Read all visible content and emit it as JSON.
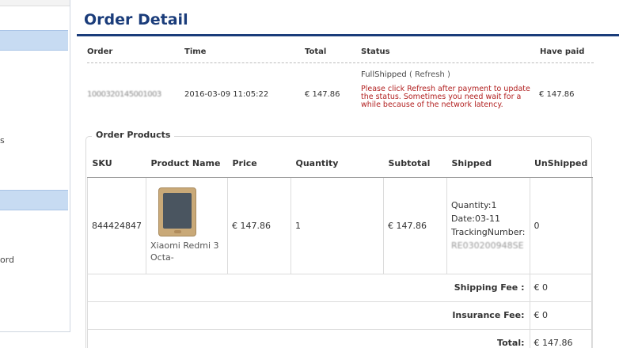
{
  "page": {
    "title": "Order Detail"
  },
  "sidebar": {
    "items": [
      "s",
      "ord"
    ]
  },
  "summary": {
    "headers": [
      "Order",
      "Time",
      "Total",
      "Status",
      "Have paid"
    ],
    "row": {
      "order_id": "1000320145001003",
      "time": "2016-03-09 11:05:22",
      "total": "€ 147.86",
      "status": "FullShipped",
      "refresh_label": "( Refresh )",
      "status_note": "Please click Refresh after payment to update the status. Sometimes you need wait for a while because of the network latency.",
      "have_paid": "€ 147.86"
    }
  },
  "products": {
    "legend": "Order Products",
    "headers": [
      "SKU",
      "Product Name",
      "Price",
      "Quantity",
      "Subtotal",
      "Shipped",
      "UnShipped"
    ],
    "items": [
      {
        "sku": "844424847",
        "name": "Xiaomi Redmi 3 Octa-",
        "price": "€ 147.86",
        "quantity": "1",
        "subtotal": "€ 147.86",
        "shipped_quantity": "Quantity:1",
        "shipped_date": "Date:03-11",
        "tracking_label": "TrackingNumber:",
        "tracking_value": "RE030200948SE",
        "unshipped": "0"
      }
    ],
    "fees": [
      {
        "label": "Shipping Fee :",
        "value": "€ 0"
      },
      {
        "label": "Insurance Fee:",
        "value": "€ 0"
      },
      {
        "label": "Total:",
        "value": "€ 147.86"
      }
    ]
  }
}
